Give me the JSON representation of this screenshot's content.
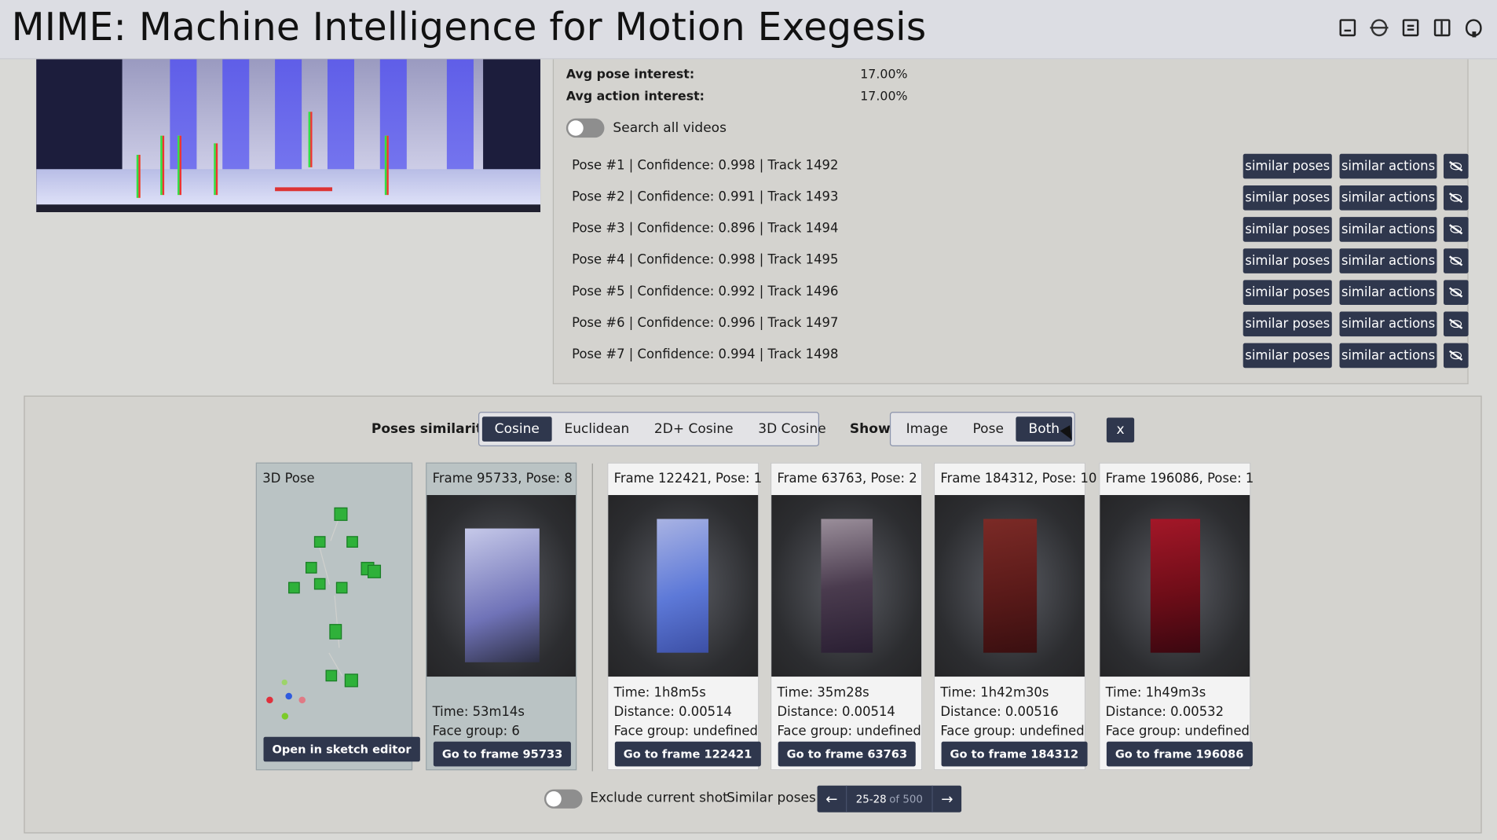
{
  "app": {
    "title": "MIME: Machine Intelligence for Motion Exegesis"
  },
  "header_icons": [
    "pdf-doc-icon",
    "logo-icon",
    "book-icon",
    "manual-icon",
    "github-icon"
  ],
  "stats": {
    "avg_pose_label": "Avg pose interest:",
    "avg_pose_value": "17.00%",
    "avg_action_label": "Avg action interest:",
    "avg_action_value": "17.00%"
  },
  "search_all": {
    "label": "Search all videos",
    "checked": false
  },
  "poses": [
    {
      "text": "Pose #1 | Confidence: 0.998 | Track 1492"
    },
    {
      "text": "Pose #2 | Confidence: 0.991 | Track 1493"
    },
    {
      "text": "Pose #3 | Confidence: 0.896 | Track 1494"
    },
    {
      "text": "Pose #4 | Confidence: 0.998 | Track 1495"
    },
    {
      "text": "Pose #5 | Confidence: 0.992 | Track 1496"
    },
    {
      "text": "Pose #6 | Confidence: 0.996 | Track 1497"
    },
    {
      "text": "Pose #7 | Confidence: 0.994 | Track 1498"
    }
  ],
  "pose_buttons": {
    "similar_poses": "similar poses",
    "similar_actions": "similar actions"
  },
  "similarity": {
    "label": "Poses similarity:",
    "options": [
      "Cosine",
      "Euclidean",
      "2D+ Cosine",
      "3D Cosine"
    ],
    "selected": "Cosine"
  },
  "show": {
    "label": "Show:",
    "options": [
      "Image",
      "Pose",
      "Both"
    ],
    "selected": "Both"
  },
  "close_label": "x",
  "pose3d_card": {
    "title": "3D Pose",
    "button": "Open in sketch editor"
  },
  "query_card": {
    "title": "Frame 95733, Pose: 8",
    "time": "Time: 53m14s",
    "face_group": "Face group: 6",
    "button": "Go to frame 95733"
  },
  "results": [
    {
      "title": "Frame 122421, Pose: 1",
      "time": "Time: 1h8m5s",
      "distance": "Distance: 0.00514",
      "face_group": "Face group: undefined",
      "button": "Go to frame 122421"
    },
    {
      "title": "Frame 63763, Pose: 2",
      "time": "Time: 35m28s",
      "distance": "Distance: 0.00514",
      "face_group": "Face group: undefined",
      "button": "Go to frame 63763"
    },
    {
      "title": "Frame 184312, Pose: 10",
      "time": "Time: 1h42m30s",
      "distance": "Distance: 0.00516",
      "face_group": "Face group: undefined",
      "button": "Go to frame 184312"
    },
    {
      "title": "Frame 196086, Pose: 1",
      "time": "Time: 1h49m3s",
      "distance": "Distance: 0.00532",
      "face_group": "Face group: undefined",
      "button": "Go to frame 196086"
    }
  ],
  "footer": {
    "exclude_label": "Exclude current shot",
    "exclude_checked": false,
    "similar_label": "Similar poses",
    "range": "25-28",
    "of_total": "of 500"
  }
}
